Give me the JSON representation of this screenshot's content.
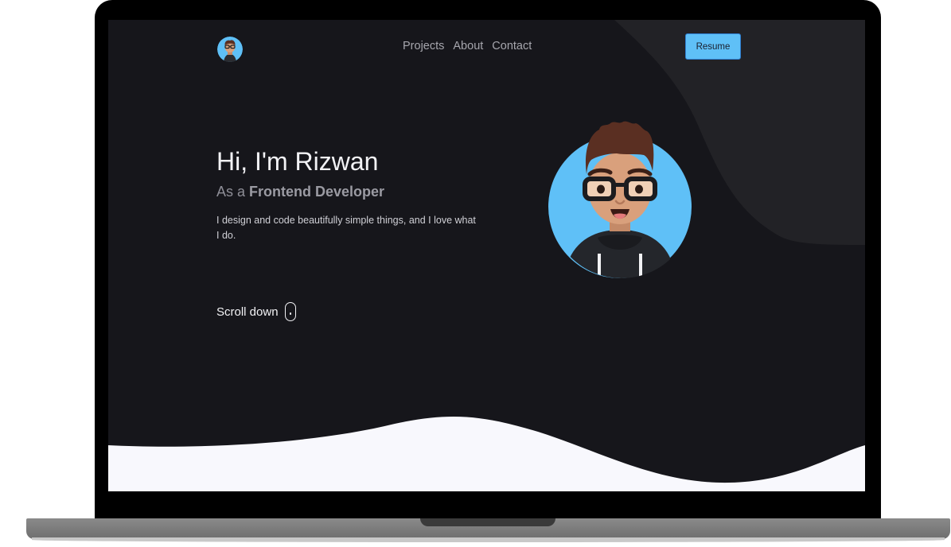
{
  "nav": {
    "avatar_icon": "user-avatar-icon",
    "links": [
      "Projects",
      "About",
      "Contact"
    ],
    "resume_label": "Resume"
  },
  "hero": {
    "title": "Hi, I'm Rizwan",
    "subtitle_prefix": "As a ",
    "subtitle_role": "Frontend Developer",
    "description": "I design and code beautifully simple things, and I love what I do.",
    "scroll_label": "Scroll down",
    "scroll_icon": "mouse-icon",
    "avatar_icon": "developer-avatar-illustration"
  },
  "colors": {
    "background": "#16161b",
    "accent_shape": "#222226",
    "accent": "#5fc0f7",
    "wave": "#f8f8fd",
    "text": "#f2f2f5",
    "muted": "#8e8e97"
  }
}
